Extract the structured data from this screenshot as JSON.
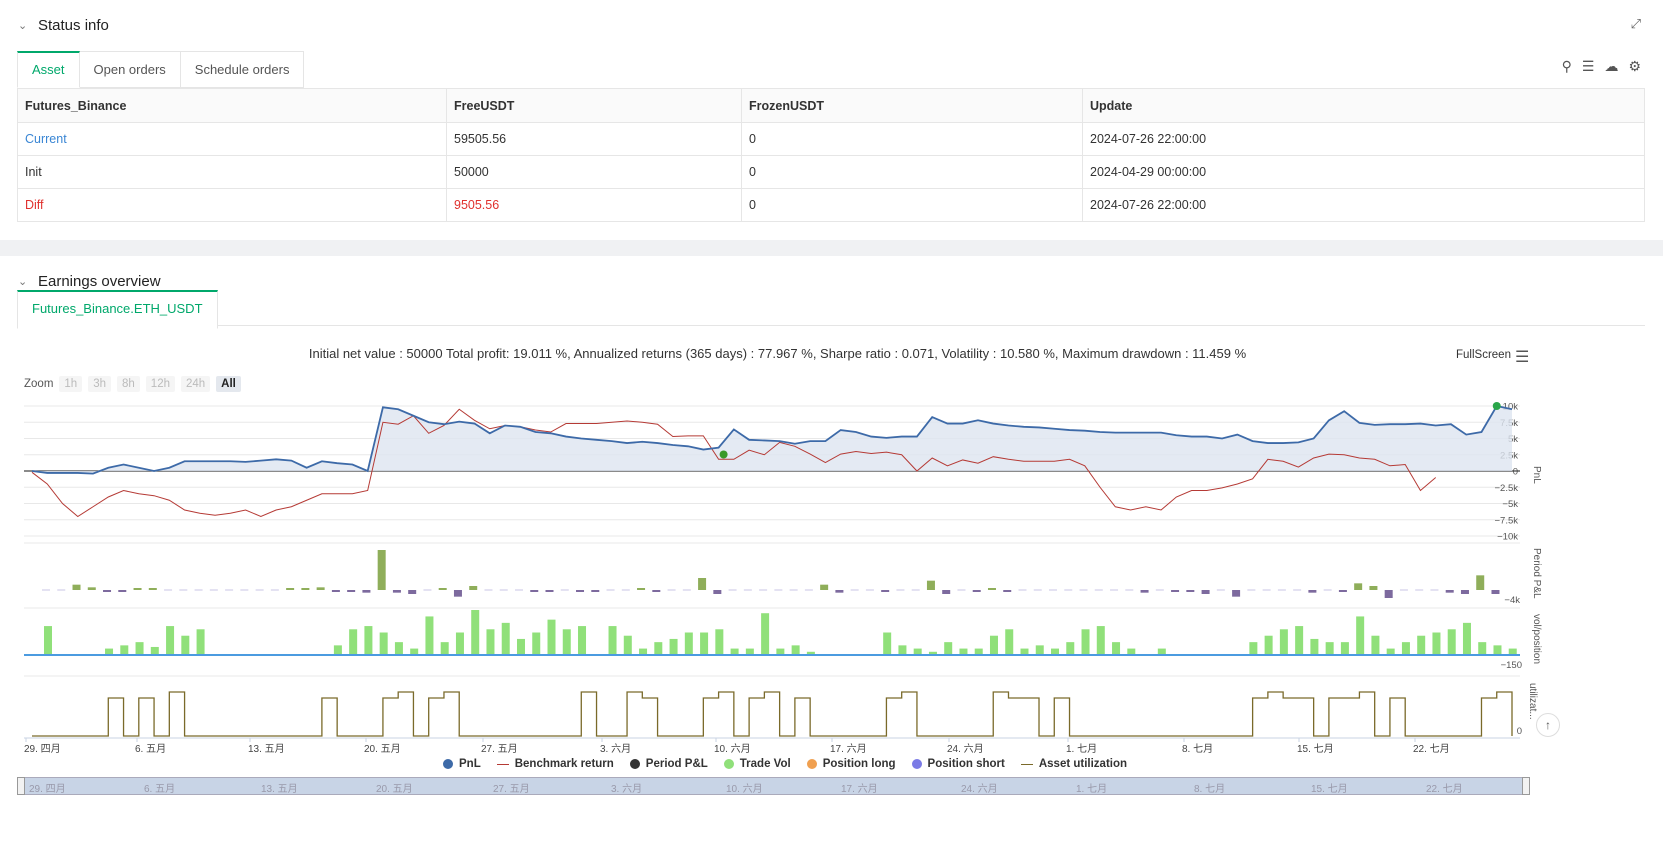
{
  "status": {
    "title": "Status info",
    "tabs": [
      "Asset",
      "Open orders",
      "Schedule orders"
    ],
    "columns": [
      "Futures_Binance",
      "FreeUSDT",
      "FrozenUSDT",
      "Update"
    ],
    "rows": [
      {
        "name": "Current",
        "free": "59505.56",
        "frozen": "0",
        "update": "2024-07-26 22:00:00"
      },
      {
        "name": "Init",
        "free": "50000",
        "frozen": "0",
        "update": "2024-04-29 00:00:00"
      },
      {
        "name": "Diff",
        "free": "9505.56",
        "frozen": "0",
        "update": "2024-07-26 22:00:00"
      }
    ]
  },
  "earnings": {
    "title": "Earnings overview",
    "tab": "Futures_Binance.ETH_USDT",
    "stats": "Initial net value : 50000 Total profit: 19.011 %, Annualized returns (365 days) : 77.967 %, Sharpe ratio : 0.071, Volatility : 10.580 %, Maximum drawdown : 11.459 %",
    "fullscreen": "FullScreen",
    "zoom_label": "Zoom",
    "zoom_options": [
      "1h",
      "3h",
      "8h",
      "12h",
      "24h",
      "All"
    ],
    "legend": [
      "PnL",
      "Benchmark return",
      "Period P&L",
      "Trade Vol",
      "Position long",
      "Position short",
      "Asset utilization"
    ],
    "colors": {
      "pnl": "#3d6aa8",
      "benchmark": "#b53a35",
      "period": "#333333",
      "trade_vol": "#90e07a",
      "pos_long": "#f0a050",
      "pos_short": "#7b7be6",
      "util": "#7a6a2a",
      "accent": "#00a86b"
    }
  },
  "chart_data": {
    "type": "line",
    "x_tick_labels": [
      "29. 四月",
      "6. 五月",
      "13. 五月",
      "20. 五月",
      "27. 五月",
      "3. 六月",
      "10. 六月",
      "17. 六月",
      "24. 六月",
      "1. 七月",
      "8. 七月",
      "15. 七月",
      "22. 七月"
    ],
    "pnl_axis_ticks": [
      "10k",
      "7.5k",
      "5k",
      "2.5k",
      "0",
      "−2.5k",
      "−5k",
      "−7.5k",
      "−10k"
    ],
    "pnl_axis_label": "PnL",
    "period_axis_label": "Period P&L",
    "period_axis_tick": "−4k",
    "vol_axis_label": "vol/position",
    "vol_axis_tick": "−150",
    "util_axis_label": "utilizat...",
    "util_axis_tick": "0",
    "ylim_pnl": [
      -10000,
      10000
    ],
    "pnl": [
      0,
      -300,
      -300,
      -300,
      -400,
      500,
      1000,
      500,
      0,
      500,
      1500,
      1500,
      1500,
      1500,
      1400,
      1600,
      1800,
      1600,
      500,
      1500,
      1200,
      1000,
      0,
      9800,
      9500,
      8500,
      7500,
      7200,
      7600,
      7300,
      5800,
      7000,
      6800,
      6000,
      5800,
      5300,
      5000,
      4800,
      4600,
      4300,
      4500,
      4300,
      4000,
      3800,
      3300,
      3600,
      6400,
      4800,
      4700,
      4600,
      4200,
      4600,
      4600,
      6300,
      6000,
      5300,
      5100,
      5300,
      5300,
      8300,
      7300,
      7300,
      7800,
      7300,
      7000,
      6800,
      6700,
      6500,
      6300,
      6200,
      6000,
      5900,
      5900,
      5900,
      5900,
      5500,
      5300,
      5300,
      5000,
      5600,
      4600,
      4300,
      4300,
      4400,
      5000,
      7800,
      9200,
      7400,
      7100,
      7200,
      7200,
      7300,
      7000,
      7200,
      5600,
      6000,
      10000,
      9500
    ],
    "benchmark": [
      -200,
      -2000,
      -5000,
      -7000,
      -5500,
      -4000,
      -3000,
      -3500,
      -3800,
      -4500,
      -6000,
      -6500,
      -6800,
      -6500,
      -6000,
      -7000,
      -6000,
      -5500,
      -4500,
      -3500,
      -3500,
      -3500,
      -3000,
      7500,
      7200,
      8500,
      5800,
      7000,
      9500,
      7800,
      6500,
      7000,
      6800,
      6300,
      6000,
      7300,
      7300,
      7300,
      7500,
      7700,
      7500,
      7200,
      5300,
      5400,
      5400,
      1800,
      1800,
      3200,
      2500,
      4400,
      3800,
      2600,
      1300,
      2600,
      3000,
      2700,
      2900,
      2500,
      0,
      2000,
      800,
      1700,
      1200,
      2200,
      1800,
      1500,
      1500,
      1500,
      1800,
      800,
      -2500,
      -5500,
      -6000,
      -5500,
      -6000,
      -4000,
      -3000,
      -3000,
      -2600,
      -2000,
      -1200,
      1800,
      1500,
      600,
      2000,
      2600,
      2500,
      2000,
      1800,
      800,
      1000,
      -3000,
      -1000
    ],
    "period_pnl": [
      0,
      0,
      400,
      200,
      -100,
      -100,
      100,
      100,
      0,
      0,
      0,
      0,
      0,
      0,
      0,
      0,
      100,
      100,
      200,
      -100,
      -100,
      -200,
      3000,
      -200,
      -300,
      0,
      100,
      -500,
      300,
      0,
      0,
      0,
      -100,
      -100,
      0,
      -100,
      -100,
      0,
      0,
      100,
      -100,
      0,
      0,
      900,
      -300,
      0,
      0,
      0,
      0,
      0,
      0,
      400,
      -200,
      0,
      0,
      -100,
      0,
      0,
      700,
      -300,
      0,
      -100,
      100,
      -100,
      0,
      0,
      0,
      0,
      0,
      0,
      0,
      0,
      -200,
      0,
      -100,
      -100,
      -300,
      0,
      -500,
      0,
      0,
      0,
      0,
      -200,
      0,
      -100,
      500,
      300,
      -600,
      0,
      0,
      0,
      -200,
      -300,
      1100,
      -300
    ],
    "trade_vol": [
      90,
      0,
      0,
      0,
      20,
      30,
      40,
      25,
      90,
      60,
      80,
      0,
      0,
      0,
      0,
      0,
      0,
      0,
      0,
      30,
      80,
      90,
      70,
      40,
      20,
      120,
      40,
      70,
      140,
      80,
      100,
      50,
      70,
      110,
      80,
      90,
      0,
      90,
      60,
      20,
      40,
      50,
      70,
      70,
      80,
      20,
      20,
      130,
      20,
      30,
      10,
      0,
      0,
      0,
      0,
      70,
      30,
      20,
      10,
      40,
      20,
      20,
      60,
      80,
      20,
      30,
      20,
      40,
      80,
      90,
      40,
      20,
      0,
      20,
      0,
      0,
      0,
      0,
      0,
      40,
      60,
      80,
      90,
      50,
      40,
      40,
      120,
      60,
      20,
      40,
      60,
      70,
      80,
      100,
      40,
      30,
      20
    ],
    "utilization": [
      0,
      0,
      0,
      0,
      0,
      1,
      0,
      1,
      0,
      1,
      0,
      0,
      0,
      0,
      0,
      0,
      0,
      0,
      0,
      1,
      0,
      0,
      0,
      1,
      1,
      0,
      1,
      1,
      0,
      0,
      0,
      0,
      0,
      0,
      0,
      0,
      1,
      0,
      0,
      1,
      1,
      0,
      0,
      0,
      1,
      1,
      0,
      1,
      1,
      0,
      1,
      0,
      0,
      0,
      0,
      0,
      1,
      1,
      0,
      0,
      0,
      0,
      0,
      1,
      1,
      1,
      0,
      1,
      0,
      0,
      0,
      0,
      0,
      0,
      0,
      0,
      0,
      0,
      0,
      0,
      1,
      1,
      1,
      1,
      0,
      1,
      1,
      1,
      0,
      1,
      0,
      0,
      0,
      0,
      0,
      1,
      1,
      0
    ]
  }
}
